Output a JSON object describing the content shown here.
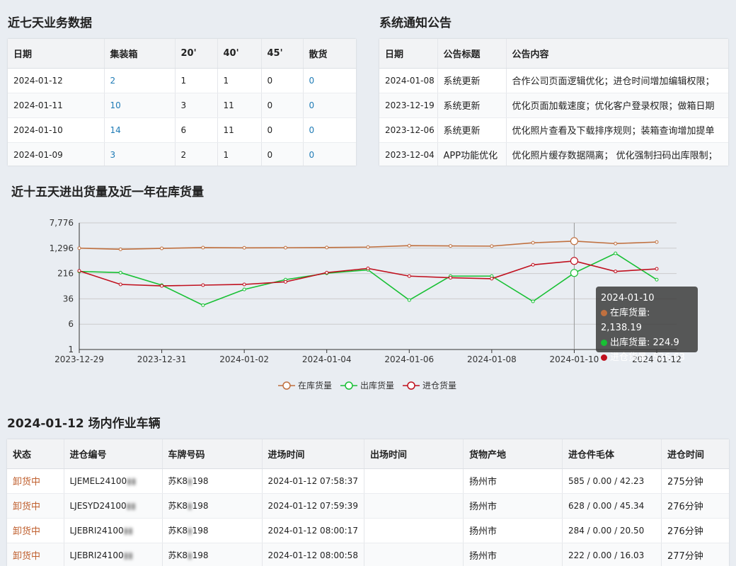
{
  "weekly": {
    "title": "近七天业务数据",
    "headers": [
      "日期",
      "集装箱",
      "20'",
      "40'",
      "45'",
      "散货"
    ],
    "rows": [
      [
        "2024-01-12",
        "2",
        "1",
        "1",
        "0",
        "0"
      ],
      [
        "2024-01-11",
        "10",
        "3",
        "11",
        "0",
        "0"
      ],
      [
        "2024-01-10",
        "14",
        "6",
        "11",
        "0",
        "0"
      ],
      [
        "2024-01-09",
        "3",
        "2",
        "1",
        "0",
        "0"
      ]
    ]
  },
  "notice": {
    "title": "系统通知公告",
    "headers": [
      "日期",
      "公告标题",
      "公告内容"
    ],
    "rows": [
      [
        "2024-01-08",
        "系统更新",
        "合作公司页面逻辑优化；进仓时间增加编辑权限；"
      ],
      [
        "2023-12-19",
        "系统更新",
        "优化页面加载速度；优化客户登录权限；做箱日期"
      ],
      [
        "2023-12-06",
        "系统更新",
        "优化照片查看及下载排序规则；装箱查询增加提单"
      ],
      [
        "2023-12-04",
        "APP功能优化",
        "优化照片缓存数据隔离； 优化强制扫码出库限制；"
      ]
    ]
  },
  "chart": {
    "title": "近十五天进出货量及近一年在库货量",
    "tooltip": {
      "date": "2024-01-10",
      "lines": [
        "在库货量: 2,138.19",
        "出库货量: 224.9",
        "进仓货量: 526.63"
      ]
    },
    "colors": {
      "stock": "#c0703f",
      "out": "#18c034",
      "in": "#c0101e"
    }
  },
  "chart_data": {
    "type": "line",
    "x": [
      "2023-12-29",
      "2023-12-30",
      "2023-12-31",
      "2024-01-01",
      "2024-01-02",
      "2024-01-03",
      "2024-01-04",
      "2024-01-05",
      "2024-01-06",
      "2024-01-07",
      "2024-01-08",
      "2024-01-09",
      "2024-01-10",
      "2024-01-11",
      "2024-01-12"
    ],
    "x_tick_labels": [
      "2023-12-29",
      "2023-12-31",
      "2024-01-02",
      "2024-01-04",
      "2024-01-06",
      "2024-01-08",
      "2024-01-10",
      "2024-01-12"
    ],
    "y_scale": "log",
    "y_ticks": [
      "1",
      "6",
      "36",
      "216",
      "1,296",
      "7,776"
    ],
    "series": [
      {
        "name": "在库货量",
        "values": [
          1300,
          1200,
          1280,
          1350,
          1330,
          1340,
          1360,
          1400,
          1550,
          1520,
          1500,
          1900,
          2138.19,
          1800,
          2000
        ]
      },
      {
        "name": "出库货量",
        "values": [
          250,
          230,
          95,
          23,
          70,
          140,
          220,
          280,
          33,
          180,
          180,
          30,
          224.9,
          900,
          140
        ]
      },
      {
        "name": "进仓货量",
        "values": [
          260,
          100,
          90,
          95,
          100,
          120,
          230,
          310,
          180,
          160,
          150,
          400,
          526.63,
          250,
          300
        ]
      }
    ],
    "legend_position": "bottom-center"
  },
  "vehicles": {
    "title": "2024-01-12 场内作业车辆",
    "headers": [
      "状态",
      "进仓编号",
      "车牌号码",
      "进场时间",
      "出场时间",
      "货物产地",
      "进仓件毛体",
      "进仓时间"
    ],
    "rows": [
      [
        "卸货中",
        "LJEMEL24100",
        "苏K8",
        "2024-01-12 07:58:37",
        "",
        "扬州市",
        "585 / 0.00 / 42.23",
        "275分钟"
      ],
      [
        "卸货中",
        "LJESYD24100",
        "苏K8",
        "2024-01-12 07:59:39",
        "",
        "扬州市",
        "628 / 0.00 / 45.34",
        "276分钟"
      ],
      [
        "卸货中",
        "LJEBRI24100",
        "苏K8",
        "2024-01-12 08:00:17",
        "",
        "扬州市",
        "284 / 0.00 / 20.50",
        "276分钟"
      ],
      [
        "卸货中",
        "LJEBRI24100",
        "苏K8",
        "2024-01-12 08:00:58",
        "",
        "扬州市",
        "222 / 0.00 / 16.03",
        "277分钟"
      ]
    ],
    "plate_suffix": [
      "198",
      "198",
      "198",
      "198"
    ]
  }
}
